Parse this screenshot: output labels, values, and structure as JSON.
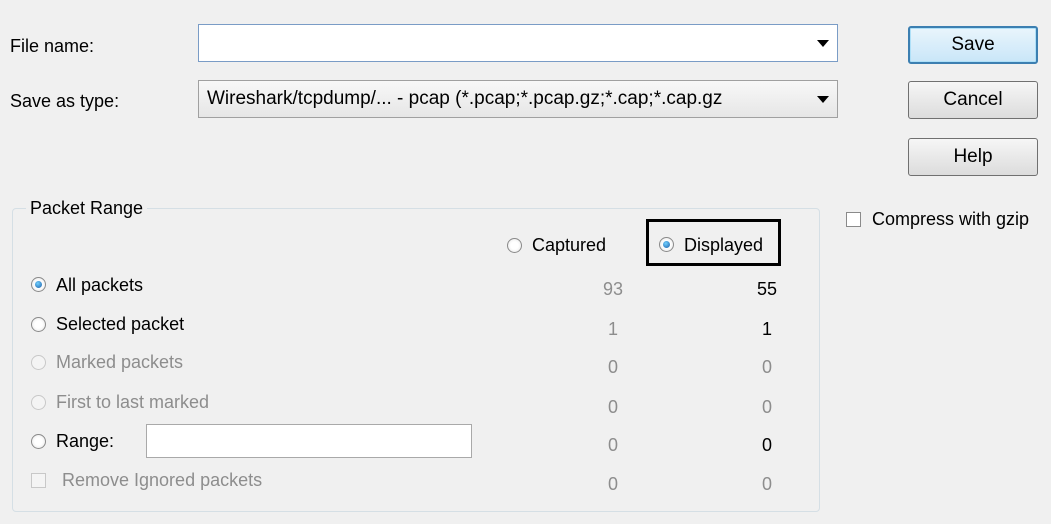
{
  "file_name": {
    "label": "File name:",
    "value": ""
  },
  "save_as_type": {
    "label": "Save as type:",
    "value": "Wireshark/tcpdump/... - pcap (*.pcap;*.pcap.gz;*.cap;*.cap.gz"
  },
  "buttons": {
    "save": "Save",
    "cancel": "Cancel",
    "help": "Help"
  },
  "compress": {
    "label": "Compress with gzip",
    "checked": false
  },
  "packet_range": {
    "title": "Packet Range",
    "captured_label": "Captured",
    "displayed_label": "Displayed",
    "selected_column": "Displayed",
    "rows": [
      {
        "label": "All packets",
        "captured": "93",
        "displayed": "55",
        "enabled": true,
        "selected": true
      },
      {
        "label": "Selected packet",
        "captured": "1",
        "displayed": "1",
        "enabled": true,
        "selected": false
      },
      {
        "label": "Marked packets",
        "captured": "0",
        "displayed": "0",
        "enabled": false,
        "selected": false
      },
      {
        "label": "First to last marked",
        "captured": "0",
        "displayed": "0",
        "enabled": false,
        "selected": false
      },
      {
        "label": "Range:",
        "captured": "0",
        "displayed": "0",
        "enabled": true,
        "selected": false,
        "input_value": ""
      },
      {
        "label": "Remove Ignored packets",
        "captured": "0",
        "displayed": "0",
        "enabled": false,
        "selected": false
      }
    ]
  }
}
